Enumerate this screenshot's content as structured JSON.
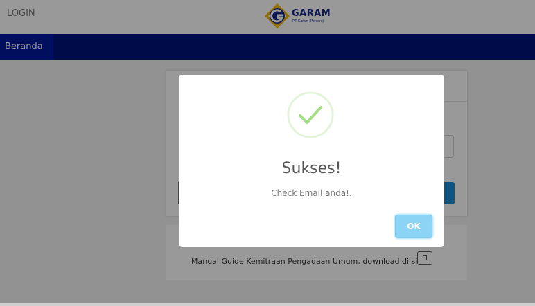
{
  "header": {
    "login_label": "LOGIN",
    "logo_icon": "garam-logo-icon",
    "brand_name": "GARAM",
    "brand_subtitle": "PT Garam (Persero)"
  },
  "nav": {
    "items": [
      {
        "label": "Beranda"
      }
    ]
  },
  "footer": {
    "manual_text": "Manual Guide Kemitraan Pengadaan Umum, download di sini",
    "download_icon": "file-icon"
  },
  "modal": {
    "icon": "checkmark-icon",
    "title": "Sukses!",
    "text": "Check Email anda!.",
    "ok_label": "OK"
  },
  "colors": {
    "navbar": "#00147a",
    "brand": "#1a2a8c",
    "success": "#a5dc86",
    "ok_button": "#8cd4f5",
    "primary_button": "#1a8bd6"
  }
}
